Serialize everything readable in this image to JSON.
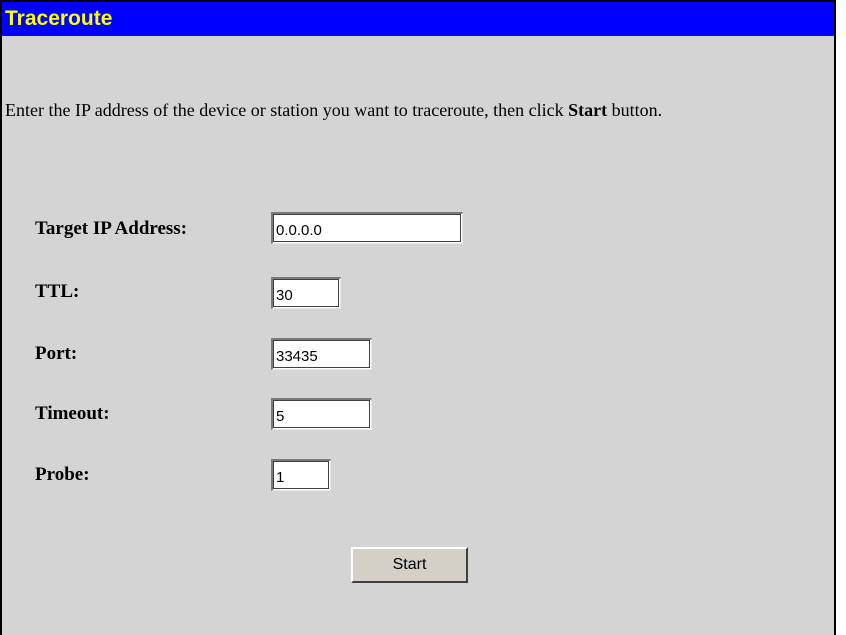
{
  "title": "Traceroute",
  "instructions": {
    "before": "Enter the IP address of the device or station you want to traceroute, then click ",
    "emphasis": "Start",
    "after": " button."
  },
  "fields": {
    "target_ip": {
      "label": "Target IP Address:",
      "value": "0.0.0.0"
    },
    "ttl": {
      "label": "TTL:",
      "value": "30"
    },
    "port": {
      "label": "Port:",
      "value": "33435"
    },
    "timeout": {
      "label": "Timeout:",
      "value": "5"
    },
    "probe": {
      "label": "Probe:",
      "value": "1"
    }
  },
  "start_button": {
    "label": "Start"
  },
  "colors": {
    "title_bar": "#0000ff",
    "title_text": "#ffff00",
    "panel_background": "#d4d4d4"
  }
}
